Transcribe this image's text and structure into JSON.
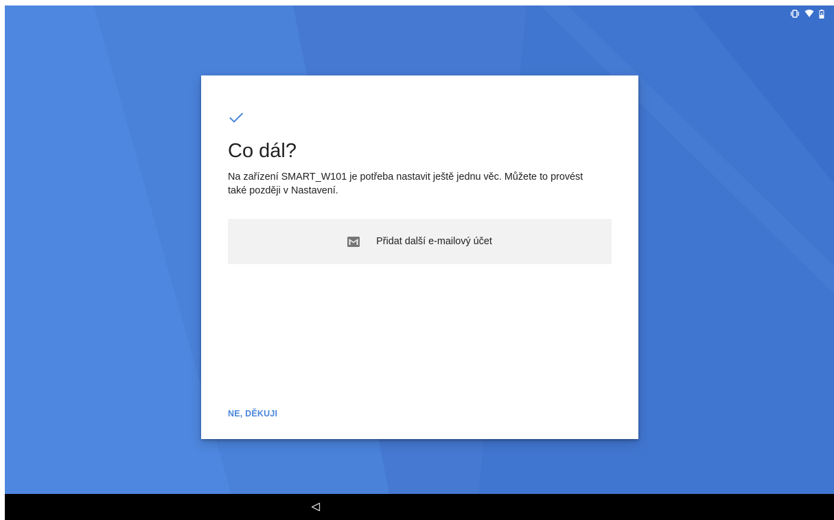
{
  "colors": {
    "wallpaper_base": "#4a80d8",
    "accent": "#4a86d9",
    "option_background": "#f2f2f2",
    "text_primary": "#212121",
    "nav_bar": "#000000"
  },
  "status_bar": {
    "icons": [
      "vibrate-icon",
      "wifi-icon",
      "battery-icon"
    ]
  },
  "dialog": {
    "icon": "check-icon",
    "title": "Co dál?",
    "description": "Na zařízení SMART_W101 je potřeba nastavit ještě jednu věc. Můžete to provést také později v Nastavení.",
    "option": {
      "icon": "mail-icon",
      "label": "Přidat další e-mailový účet"
    },
    "skip_label": "NE, DĚKUJI"
  },
  "nav_bar": {
    "icons": [
      "back-icon"
    ]
  }
}
